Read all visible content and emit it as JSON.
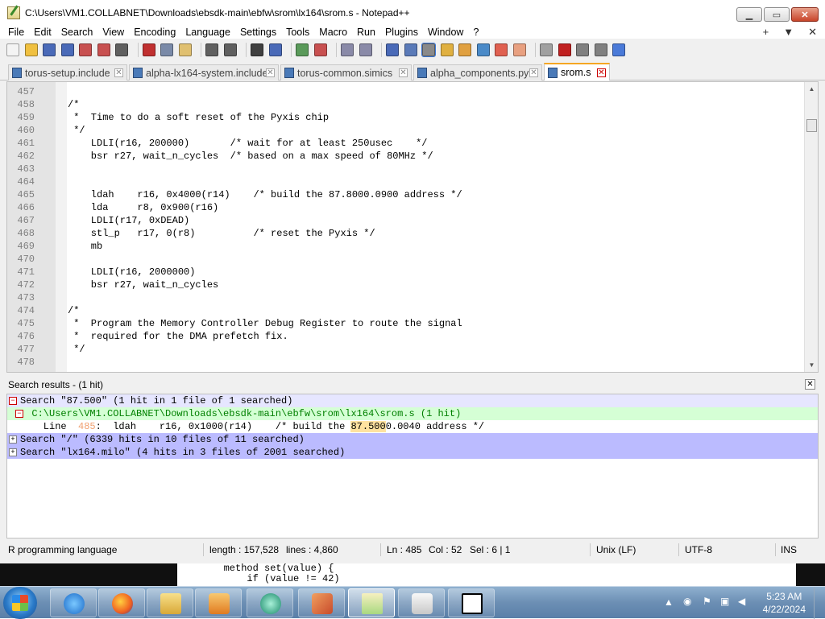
{
  "window": {
    "title": "C:\\Users\\VM1.COLLABNET\\Downloads\\ebsdk-main\\ebfw\\srom\\lx164\\srom.s - Notepad++",
    "buttons": [
      "minimize",
      "maximize",
      "close"
    ]
  },
  "menu": {
    "items": [
      "File",
      "Edit",
      "Search",
      "View",
      "Encoding",
      "Language",
      "Settings",
      "Tools",
      "Macro",
      "Run",
      "Plugins",
      "Window",
      "?"
    ],
    "right": [
      "+",
      "▼",
      "✕"
    ]
  },
  "toolbar": {
    "icons": [
      "new-file-icon",
      "open-file-icon",
      "save-icon",
      "save-all-icon",
      "close-icon",
      "close-all-icon",
      "print-icon",
      "cut-icon",
      "copy-icon",
      "paste-icon",
      "undo-icon",
      "redo-icon",
      "find-icon",
      "replace-icon",
      "zoom-in-icon",
      "zoom-out-icon",
      "sync-vertical-icon",
      "sync-horizontal-icon",
      "word-wrap-icon",
      "show-all-chars-icon",
      "indent-guide-icon",
      "udl-icon",
      "doc-map-icon",
      "function-list-icon",
      "folder-workspace-icon",
      "monitoring-icon",
      "record-macro-icon",
      "stop-macro-icon",
      "play-macro-icon",
      "run-macro-multiple-icon",
      "save-macro-icon"
    ]
  },
  "tabs": [
    {
      "label": "torus-setup.include",
      "active": false
    },
    {
      "label": "alpha-lx164-system.include",
      "active": false
    },
    {
      "label": "torus-common.simics",
      "active": false
    },
    {
      "label": "alpha_components.py",
      "active": false
    },
    {
      "label": "srom.s",
      "active": true
    }
  ],
  "editor": {
    "lines": [
      {
        "num": "457",
        "text": ""
      },
      {
        "num": "458",
        "text": "/*"
      },
      {
        "num": "459",
        "text": " *  Time to do a soft reset of the Pyxis chip"
      },
      {
        "num": "460",
        "text": " */"
      },
      {
        "num": "461",
        "text": "    LDLI(r16, 200000)       /* wait for at least 250usec    */"
      },
      {
        "num": "462",
        "text": "    bsr r27, wait_n_cycles  /* based on a max speed of 80MHz */"
      },
      {
        "num": "463",
        "text": ""
      },
      {
        "num": "464",
        "text": ""
      },
      {
        "num": "465",
        "text": "    ldah    r16, 0x4000(r14)    /* build the 87.8000.0900 address */"
      },
      {
        "num": "466",
        "text": "    lda     r8, 0x900(r16)"
      },
      {
        "num": "467",
        "text": "    LDLI(r17, 0xDEAD)"
      },
      {
        "num": "468",
        "text": "    stl_p   r17, 0(r8)          /* reset the Pyxis */"
      },
      {
        "num": "469",
        "text": "    mb"
      },
      {
        "num": "470",
        "text": ""
      },
      {
        "num": "471",
        "text": "    LDLI(r16, 2000000)"
      },
      {
        "num": "472",
        "text": "    bsr r27, wait_n_cycles"
      },
      {
        "num": "473",
        "text": ""
      },
      {
        "num": "474",
        "text": "/*"
      },
      {
        "num": "475",
        "text": " *  Program the Memory Controller Debug Register to route the signal"
      },
      {
        "num": "476",
        "text": " *  required for the DMA prefetch fix."
      },
      {
        "num": "477",
        "text": " */"
      },
      {
        "num": "478",
        "text": ""
      }
    ]
  },
  "search_panel": {
    "title": "Search results - (1 hit)",
    "close_label": "✕",
    "rows": [
      {
        "kind": "search-first",
        "box": "−",
        "text": "Search \"87.500\" (1 hit in 1 file of 1 searched)"
      },
      {
        "kind": "file",
        "box": "−",
        "text": "  C:\\Users\\VM1.COLLABNET\\Downloads\\ebsdk-main\\ebfw\\srom\\lx164\\srom.s (1 hit)"
      },
      {
        "kind": "hit",
        "prefix": "    Line  ",
        "lnum": "485",
        "middle": ":  ldah    r16, 0x1000(r14)    /* build the ",
        "match": "87.500",
        "suffix": "0.0040 address */"
      },
      {
        "kind": "search",
        "box": "+",
        "text": "Search \"/\" (6339 hits in 10 files of 11 searched)"
      },
      {
        "kind": "search",
        "box": "+",
        "text": "Search \"lx164.milo\" (4 hits in 3 files of 2001 searched)"
      }
    ]
  },
  "status": {
    "language": "R programming language",
    "length": "length : 157,528",
    "lines": "lines : 4,860",
    "ln": "Ln : 485",
    "col": "Col : 52",
    "sel": "Sel : 6 | 1",
    "eol": "Unix (LF)",
    "encoding": "UTF-8",
    "mode": "INS"
  },
  "background_window": {
    "line1": "        method set(value) {",
    "line2": "            if (value != 42)"
  },
  "taskbar": {
    "apps": [
      "internet-explorer-icon",
      "firefox-icon",
      "file-explorer-icon",
      "media-player-icon",
      "app-icon",
      "matlab-icon",
      "notepad-plus-plus-icon",
      "hxd-icon",
      "7zip-icon"
    ],
    "clock_time": "5:23 AM",
    "clock_date": "4/22/2024"
  }
}
